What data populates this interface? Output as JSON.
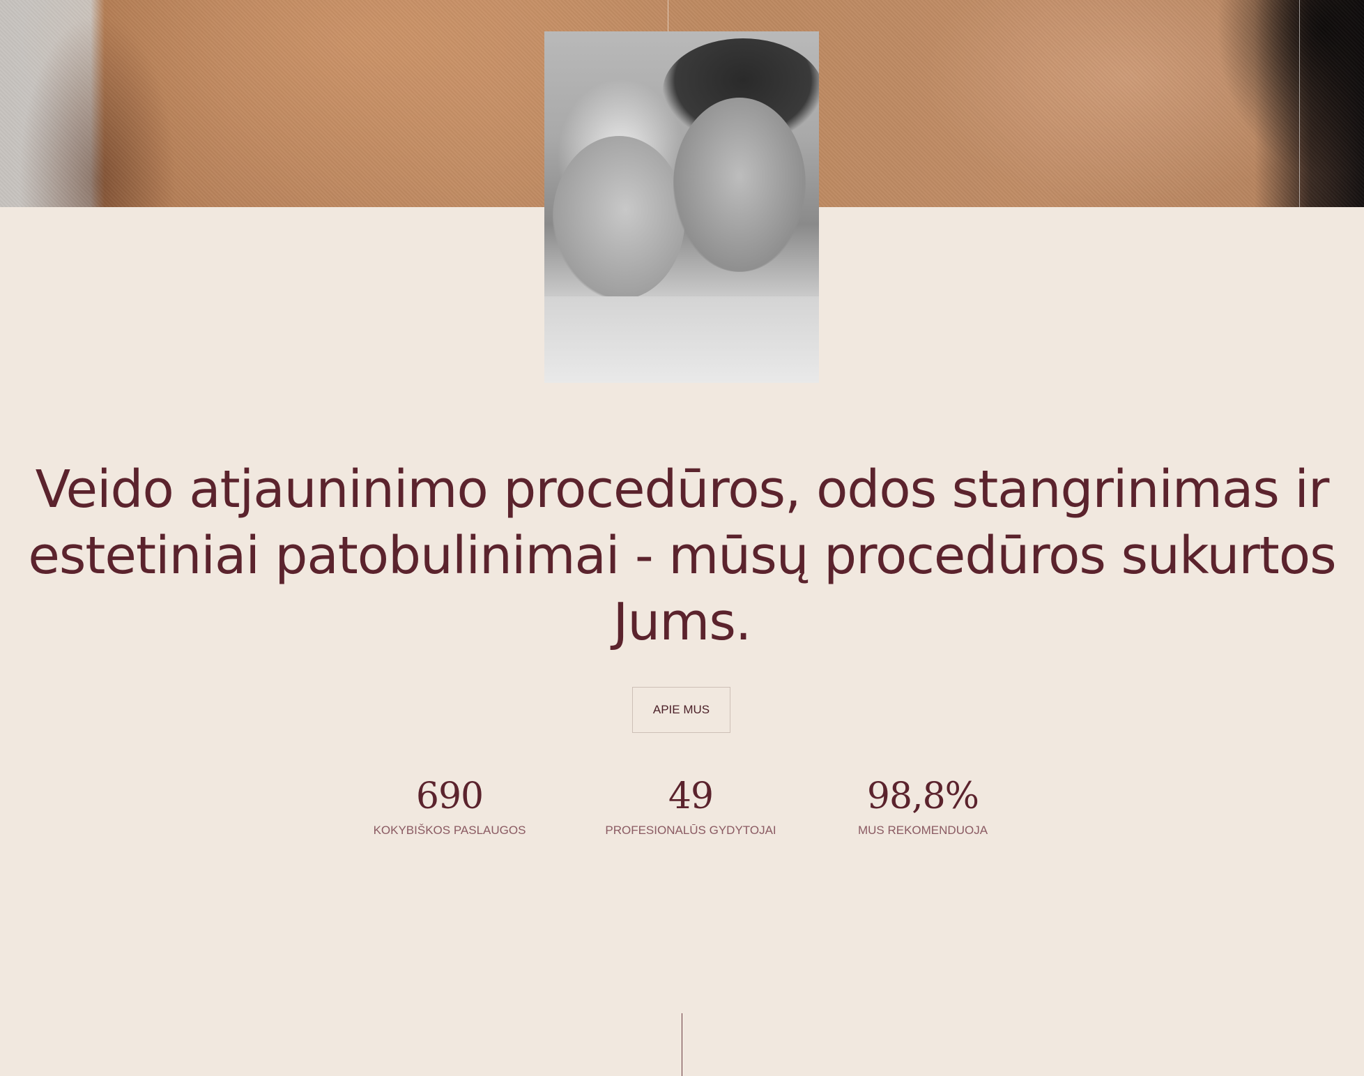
{
  "hero": {
    "portrait_alt": "two women portrait"
  },
  "headline": {
    "text": "Veido atjauninimo procedūros, odos stangrinimas ir estetiniai patobulinimai - mūsų procedūros sukurtos Jums."
  },
  "about_button": {
    "label": "APIE MUS"
  },
  "stats": [
    {
      "value": "690",
      "label": "KOKYBIŠKOS PASLAUGOS"
    },
    {
      "value": "49",
      "label": "PROFESIONALŪS GYDYTOJAI"
    },
    {
      "value": "98,8%",
      "label": "MUS REKOMENDUOJA"
    }
  ],
  "colors": {
    "background": "#f1e8df",
    "brand": "#5b232d",
    "label": "#8a5a62"
  }
}
